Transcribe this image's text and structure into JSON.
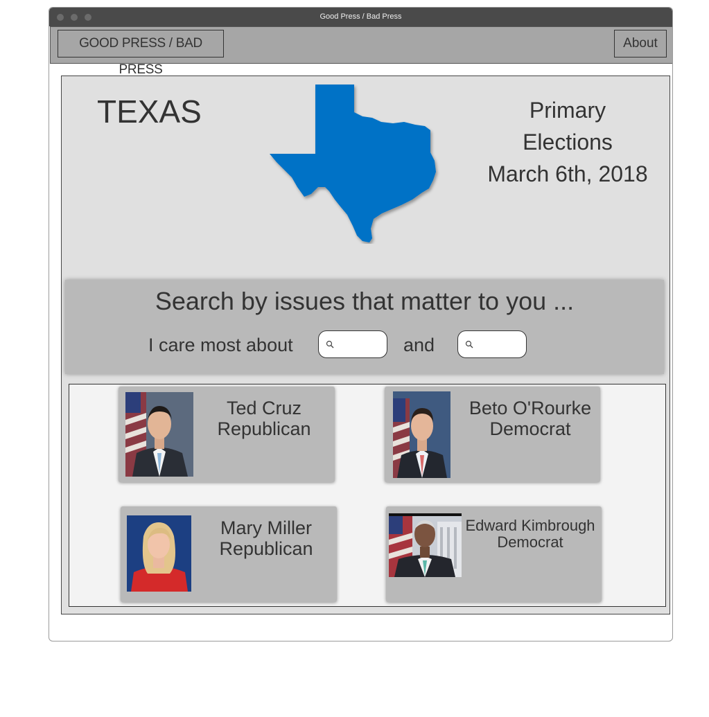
{
  "window": {
    "title": "Good Press / Bad Press"
  },
  "nav": {
    "brand": "GOOD PRESS / BAD PRESS",
    "about": "About"
  },
  "state": {
    "name": "TEXAS",
    "map_color": "#0072c6"
  },
  "election": {
    "line1": "Primary",
    "line2": "Elections",
    "date": "March 6th, 2018"
  },
  "search": {
    "heading": "Search by issues that matter to you ...",
    "care_label": "I care most about",
    "and_label": "and",
    "issue1_value": "",
    "issue2_value": ""
  },
  "candidates": [
    {
      "name": "Ted Cruz",
      "party": "Republican"
    },
    {
      "name": "Beto O'Rourke",
      "party": "Democrat"
    },
    {
      "name": "Mary Miller",
      "party": "Republican"
    },
    {
      "name": "Edward Kimbrough",
      "party": "Democrat"
    }
  ]
}
